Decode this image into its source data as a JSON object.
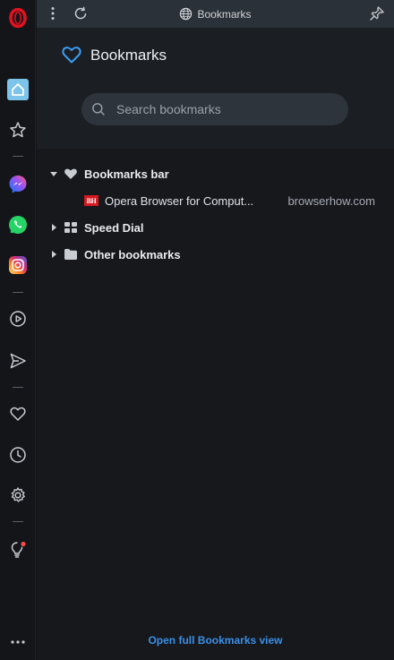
{
  "topbar": {
    "title": "Bookmarks",
    "icons": [
      "more-vertical-icon",
      "reload-icon",
      "globe-icon",
      "pin-icon"
    ]
  },
  "header": {
    "title": "Bookmarks",
    "search_placeholder": "Search bookmarks"
  },
  "sidebar": {
    "items": [
      {
        "icon": "opera-logo",
        "color": "#e0121f"
      },
      {
        "icon": "home-icon",
        "active": true,
        "color": "#7cc4ea"
      },
      {
        "icon": "star-icon"
      },
      {
        "icon": "messenger-icon",
        "color": "#a052f0"
      },
      {
        "icon": "whatsapp-icon",
        "color": "#25d366"
      },
      {
        "icon": "instagram-icon",
        "color": "#e1306c"
      },
      {
        "icon": "player-icon"
      },
      {
        "icon": "send-icon"
      },
      {
        "icon": "heart-icon"
      },
      {
        "icon": "history-icon"
      },
      {
        "icon": "settings-icon"
      },
      {
        "icon": "lightbulb-icon",
        "badge_color": "#ff4a4a"
      },
      {
        "icon": "more-horizontal-icon"
      }
    ]
  },
  "tree": {
    "bookmarks_bar": {
      "label": "Bookmarks bar",
      "expanded": true,
      "children": [
        {
          "title": "Opera Browser for Comput...",
          "url": "browserhow.com",
          "favicon_text": "BH"
        }
      ]
    },
    "speed_dial": {
      "label": "Speed Dial",
      "expanded": false
    },
    "other_bookmarks": {
      "label": "Other bookmarks",
      "expanded": false
    }
  },
  "footer": {
    "link": "Open full Bookmarks view",
    "link_color": "#3b8fe8"
  }
}
